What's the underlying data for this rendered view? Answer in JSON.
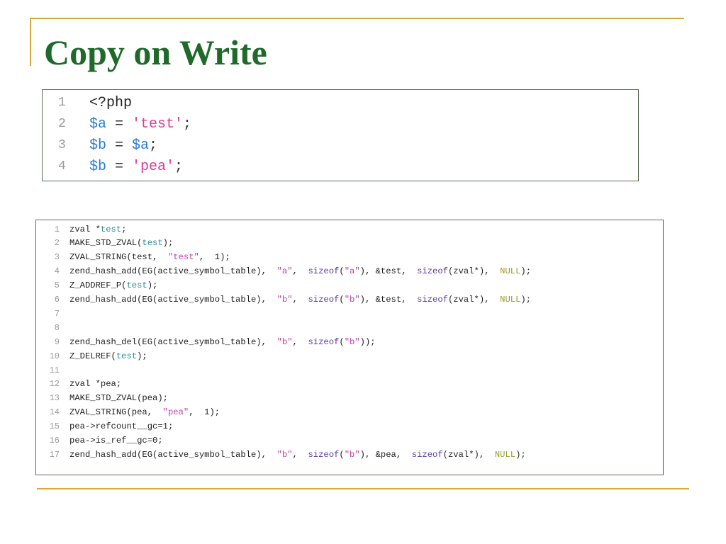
{
  "title": "Copy on Write",
  "php_code": [
    {
      "num": "1",
      "tokens": [
        {
          "t": "<?php",
          "c": "php"
        }
      ]
    },
    {
      "num": "2",
      "tokens": [
        {
          "t": "$a",
          "c": "var"
        },
        {
          "t": " = ",
          "c": "op"
        },
        {
          "t": "'test'",
          "c": "lstr"
        },
        {
          "t": ";",
          "c": "op"
        }
      ]
    },
    {
      "num": "3",
      "tokens": [
        {
          "t": "$b",
          "c": "var"
        },
        {
          "t": " = ",
          "c": "op"
        },
        {
          "t": "$a",
          "c": "var"
        },
        {
          "t": ";",
          "c": "op"
        }
      ]
    },
    {
      "num": "4",
      "tokens": [
        {
          "t": "$b",
          "c": "var"
        },
        {
          "t": " = ",
          "c": "op"
        },
        {
          "t": "'pea'",
          "c": "lstr"
        },
        {
          "t": ";",
          "c": "op"
        }
      ]
    }
  ],
  "c_code": [
    {
      "num": "1",
      "tokens": [
        {
          "t": "zval *",
          "c": "def"
        },
        {
          "t": "test",
          "c": "teal"
        },
        {
          "t": ";",
          "c": "def"
        }
      ]
    },
    {
      "num": "2",
      "tokens": [
        {
          "t": "MAKE_STD_ZVAL(",
          "c": "def"
        },
        {
          "t": "test",
          "c": "teal"
        },
        {
          "t": ");",
          "c": "def"
        }
      ]
    },
    {
      "num": "3",
      "tokens": [
        {
          "t": "ZVAL_STRING(test,  ",
          "c": "def"
        },
        {
          "t": "\"test\"",
          "c": "str"
        },
        {
          "t": ",  1);",
          "c": "def"
        }
      ]
    },
    {
      "num": "4",
      "tokens": [
        {
          "t": "zend_hash_add(EG(active_symbol_table),  ",
          "c": "def"
        },
        {
          "t": "\"a\"",
          "c": "str"
        },
        {
          "t": ",  ",
          "c": "def"
        },
        {
          "t": "sizeof",
          "c": "kw"
        },
        {
          "t": "(",
          "c": "def"
        },
        {
          "t": "\"a\"",
          "c": "str"
        },
        {
          "t": "), &test,  ",
          "c": "def"
        },
        {
          "t": "sizeof",
          "c": "kw"
        },
        {
          "t": "(zval*),  ",
          "c": "def"
        },
        {
          "t": "NULL",
          "c": "null"
        },
        {
          "t": ");",
          "c": "def"
        }
      ]
    },
    {
      "num": "5",
      "tokens": [
        {
          "t": "Z_ADDREF_P(",
          "c": "def"
        },
        {
          "t": "test",
          "c": "teal"
        },
        {
          "t": ");",
          "c": "def"
        }
      ]
    },
    {
      "num": "6",
      "tokens": [
        {
          "t": "zend_hash_add(EG(active_symbol_table),  ",
          "c": "def"
        },
        {
          "t": "\"b\"",
          "c": "str"
        },
        {
          "t": ",  ",
          "c": "def"
        },
        {
          "t": "sizeof",
          "c": "kw"
        },
        {
          "t": "(",
          "c": "def"
        },
        {
          "t": "\"b\"",
          "c": "str"
        },
        {
          "t": "), &test,  ",
          "c": "def"
        },
        {
          "t": "sizeof",
          "c": "kw"
        },
        {
          "t": "(zval*),  ",
          "c": "def"
        },
        {
          "t": "NULL",
          "c": "null"
        },
        {
          "t": ");",
          "c": "def"
        }
      ]
    },
    {
      "num": "7",
      "tokens": []
    },
    {
      "num": "8",
      "tokens": []
    },
    {
      "num": "9",
      "tokens": [
        {
          "t": "zend_hash_del(EG(active_symbol_table),  ",
          "c": "def"
        },
        {
          "t": "\"b\"",
          "c": "str"
        },
        {
          "t": ",  ",
          "c": "def"
        },
        {
          "t": "sizeof",
          "c": "kw"
        },
        {
          "t": "(",
          "c": "def"
        },
        {
          "t": "\"b\"",
          "c": "str"
        },
        {
          "t": "));",
          "c": "def"
        }
      ]
    },
    {
      "num": "10",
      "tokens": [
        {
          "t": "Z_DELREF(",
          "c": "def"
        },
        {
          "t": "test",
          "c": "teal"
        },
        {
          "t": ");",
          "c": "def"
        }
      ]
    },
    {
      "num": "11",
      "tokens": []
    },
    {
      "num": "12",
      "tokens": [
        {
          "t": "zval *pea;",
          "c": "def"
        }
      ]
    },
    {
      "num": "13",
      "tokens": [
        {
          "t": "MAKE_STD_ZVAL(pea);",
          "c": "def"
        }
      ]
    },
    {
      "num": "14",
      "tokens": [
        {
          "t": "ZVAL_STRING(pea,  ",
          "c": "def"
        },
        {
          "t": "\"pea\"",
          "c": "str"
        },
        {
          "t": ",  1);",
          "c": "def"
        }
      ]
    },
    {
      "num": "15",
      "tokens": [
        {
          "t": "pea->refcount__gc=1;",
          "c": "def"
        }
      ]
    },
    {
      "num": "16",
      "tokens": [
        {
          "t": "pea->is_ref__gc=0;",
          "c": "def"
        }
      ]
    },
    {
      "num": "17",
      "tokens": [
        {
          "t": "zend_hash_add(EG(active_symbol_table),  ",
          "c": "def"
        },
        {
          "t": "\"b\"",
          "c": "str"
        },
        {
          "t": ",  ",
          "c": "def"
        },
        {
          "t": "sizeof",
          "c": "kw"
        },
        {
          "t": "(",
          "c": "def"
        },
        {
          "t": "\"b\"",
          "c": "str"
        },
        {
          "t": "), &pea,  ",
          "c": "def"
        },
        {
          "t": "sizeof",
          "c": "kw"
        },
        {
          "t": "(zval*),  ",
          "c": "def"
        },
        {
          "t": "NULL",
          "c": "null"
        },
        {
          "t": ");",
          "c": "def"
        }
      ]
    }
  ]
}
